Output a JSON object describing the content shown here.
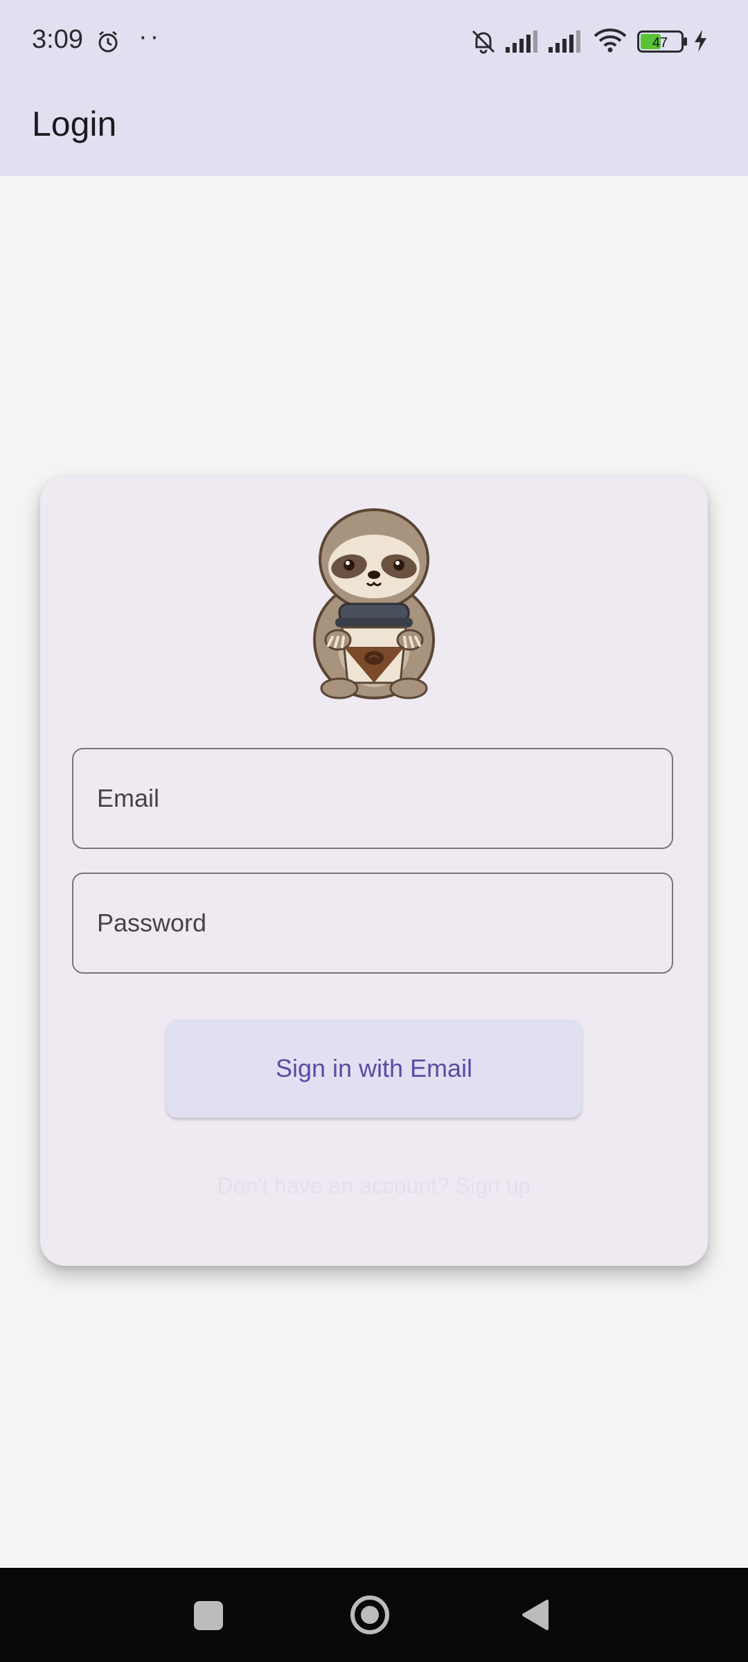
{
  "status_bar": {
    "time": "3:09",
    "dots": "··",
    "battery": "47",
    "icons": [
      "alarm-icon",
      "mute-icon",
      "signal-icon",
      "signal-icon",
      "wifi-icon",
      "battery-icon",
      "charging-icon"
    ]
  },
  "app_bar": {
    "title": "Login"
  },
  "form": {
    "logo": "sloth-coffee-mascot",
    "email_label": "Email",
    "password_label": "Password",
    "signin_label": "Sign in with Email",
    "signup_text": "Don't have an account? Sign up"
  },
  "nav_bar": {
    "icons": [
      "recents-icon",
      "home-icon",
      "back-icon"
    ]
  },
  "colors": {
    "top_bar": "#e1e0f1",
    "background": "#f5f4f5",
    "card": "#efe9f1",
    "button": "#e1e0f3",
    "button_text": "#5b4ba2",
    "outline": "#78757e"
  }
}
